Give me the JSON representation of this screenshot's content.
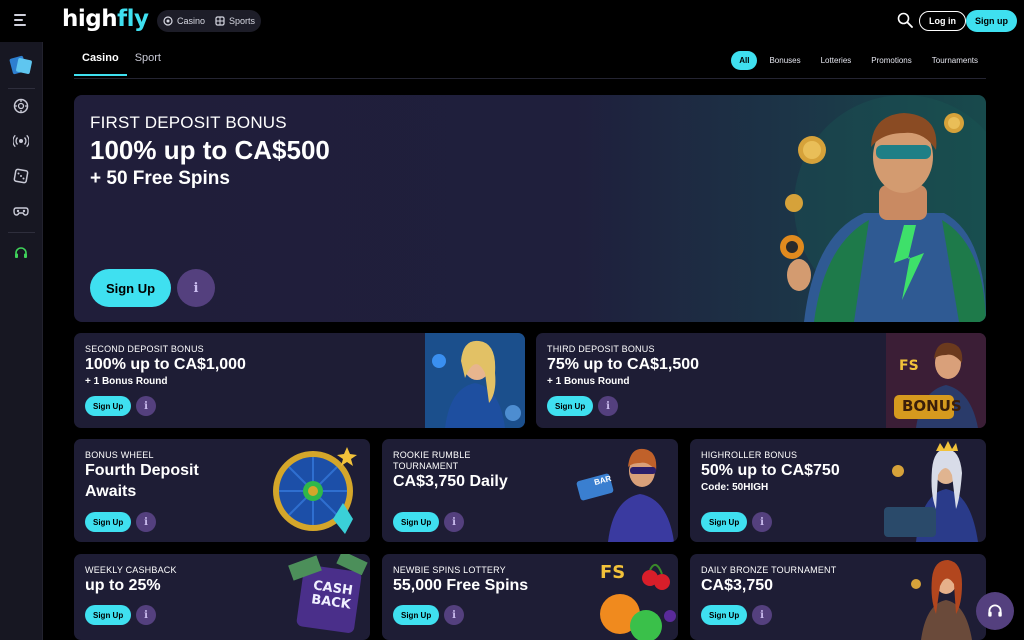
{
  "header": {
    "logo": {
      "part1": "high",
      "part2": "fly"
    },
    "modes": [
      {
        "label": "Casino",
        "icon": "casino-chip-icon"
      },
      {
        "label": "Sports",
        "icon": "sports-ball-icon"
      }
    ],
    "login_label": "Log in",
    "signup_label": "Sign up"
  },
  "sidebar": {
    "icons": [
      "promo-cards-icon",
      "casino-chip-icon",
      "live-casino-icon",
      "dice-icon",
      "esports-controller-icon",
      "support-headset-icon"
    ]
  },
  "tabs": [
    {
      "label": "Casino",
      "active": true
    },
    {
      "label": "Sport",
      "active": false
    }
  ],
  "filters": [
    {
      "label": "All",
      "active": true
    },
    {
      "label": "Bonuses",
      "active": false
    },
    {
      "label": "Lotteries",
      "active": false
    },
    {
      "label": "Promotions",
      "active": false
    },
    {
      "label": "Tournaments",
      "active": false
    }
  ],
  "hero": {
    "label": "FIRST DEPOSIT BONUS",
    "title": "100% up to  CA$500",
    "subtitle": "+ 50 Free Spins",
    "button": "Sign Up",
    "info": "i"
  },
  "promos": [
    {
      "label": "SECOND DEPOSIT BONUS",
      "title": "100% up to  CA$1,000",
      "subtitle": "+ 1 Bonus Round",
      "button": "Sign Up",
      "info": "i"
    },
    {
      "label": "THIRD DEPOSIT BONUS",
      "title": "75% up to  CA$1,500",
      "subtitle": "+ 1 Bonus Round",
      "button": "Sign Up",
      "info": "i"
    },
    {
      "label": "BONUS WHEEL",
      "title": "Fourth Deposit Awaits",
      "button": "Sign Up",
      "info": "i"
    },
    {
      "label": "ROOKIE RUMBLE TOURNAMENT",
      "title": "CA$3,750 Daily",
      "button": "Sign Up",
      "info": "i"
    },
    {
      "label": "HIGHROLLER BONUS",
      "title": "50% up to CA$750",
      "subtitle": "Code: 50HIGH",
      "button": "Sign Up",
      "info": "i"
    },
    {
      "label": "WEEKLY CASHBACK",
      "title": "up to 25%",
      "button": "Sign Up",
      "info": "i"
    },
    {
      "label": "NEWBIE SPINS LOTTERY",
      "title": "55,000 Free Spins",
      "button": "Sign Up",
      "info": "i"
    },
    {
      "label": "DAILY BRONZE TOURNAMENT",
      "title": "CA$3,750",
      "button": "Sign Up",
      "info": "i"
    }
  ],
  "art_text": {
    "fs_badge": "FS",
    "bonus_badge": "BONUS",
    "bar_sign": "BAR",
    "cashback_line1": "CASH",
    "cashback_line2": "BACK"
  },
  "colors": {
    "accent": "#3fe0f0",
    "card_bg": "#1e1d35",
    "info_bg": "#54407e",
    "sidebar_bg": "#171722"
  }
}
